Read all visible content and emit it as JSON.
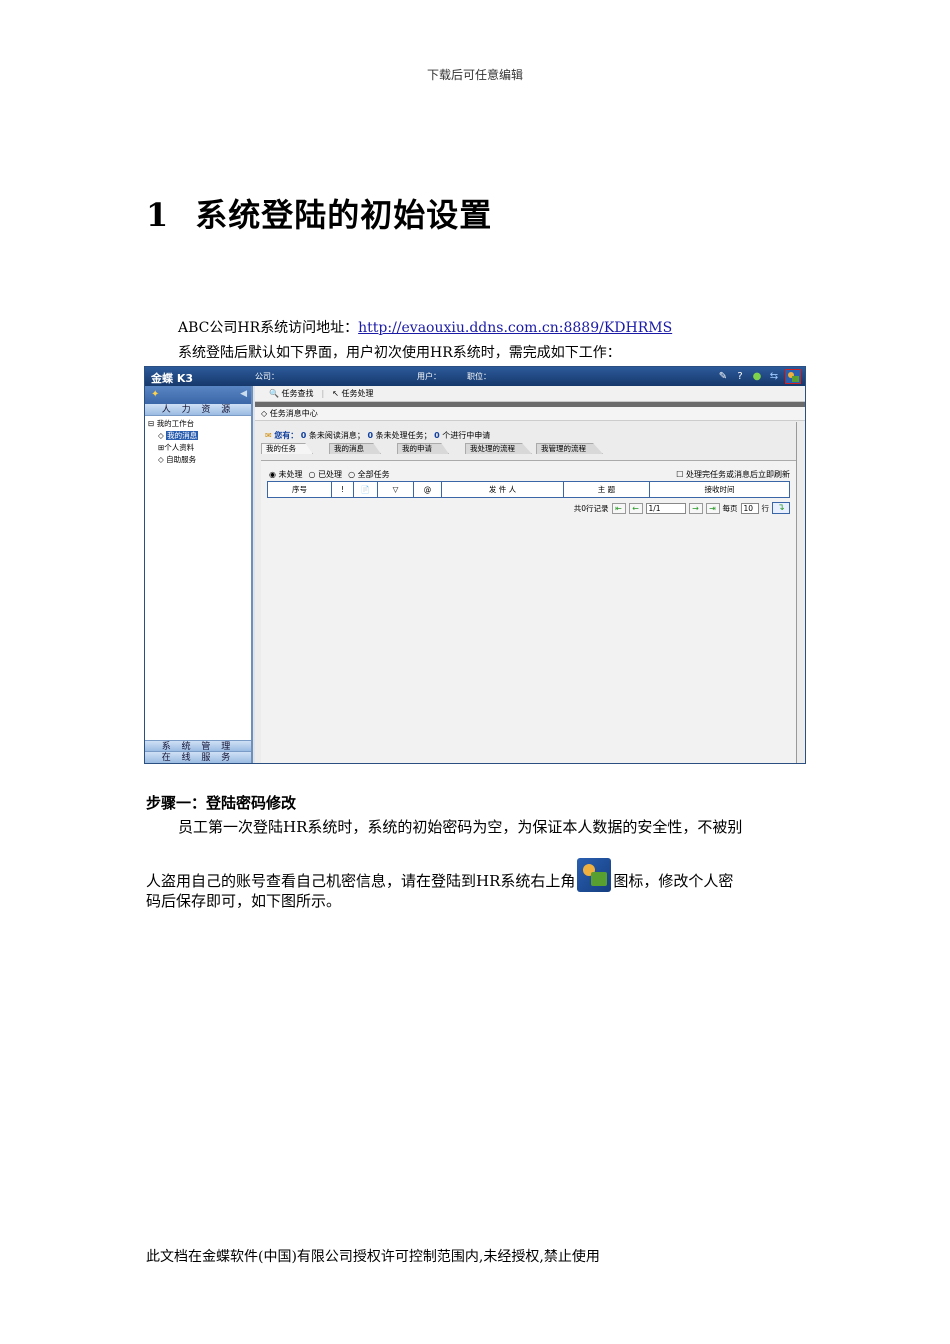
{
  "doc": {
    "header_note": "下载后可任意编辑",
    "heading_number": "1",
    "heading_text": "系统登陆的初始设置",
    "access_label": "ABC公司HR系统访问地址：",
    "access_url": "http://evaouxiu.ddns.com.cn:8889/KDHRMS",
    "intro_line": "系统登陆后默认如下界面，用户初次使用HR系统时，需完成如下工作：",
    "step1_title": "步骤一：登陆密码修改",
    "body_line1": "员工第一次登陆HR系统时，系统的初始密码为空，为保证本人数据的安全性，不被别",
    "body_line2_a": "人盗用自己的账号查看自己机密信息，请在登陆到HR系统右上角",
    "body_line2_b": "图标，修改个人密",
    "body_line3": "码后保存即可，如下图所示。",
    "footer_note": "此文档在金蝶软件(中国)有限公司授权许可控制范围内,未经授权,禁止使用"
  },
  "app": {
    "brand": "金蝶 K3",
    "company_label": "公司：",
    "user_label": "用户：",
    "position_label": "职位：",
    "top_icons": [
      "tool-icon",
      "help-icon",
      "status-dot-icon",
      "arrows-icon",
      "key-user-icon"
    ],
    "sidebar": {
      "category_top": "人 力 资 源",
      "tree": [
        {
          "label": "我的工作台",
          "prefix": "⊟"
        },
        {
          "label": "我的消息",
          "prefix": "◇",
          "selected": true
        },
        {
          "label": "个人资料",
          "prefix": "⊞"
        },
        {
          "label": "自助服务",
          "prefix": "◇"
        }
      ],
      "category_bottom1": "系 统 管 理",
      "category_bottom2": "在 线 服 务"
    },
    "toolbar": {
      "task_search": "任务查找",
      "task_process": "任务处理"
    },
    "message_center": "任务消息中心",
    "stats": {
      "prefix": "您有：",
      "unread_count": "0",
      "unread_label": "条未阅读消息；",
      "pending_count": "0",
      "pending_label": "条未处理任务；",
      "applying_count": "0",
      "applying_label": "个进行中申请"
    },
    "tabs": [
      "我的任务",
      "我的消息",
      "我的申请",
      "我处理的流程",
      "我管理的流程"
    ],
    "filters": {
      "unprocessed": "未处理",
      "processed": "已处理",
      "all": "全部任务",
      "refresh_option": "处理完任务或消息后立即刷新"
    },
    "columns": [
      "序号",
      "!",
      "📄",
      "▽",
      "@",
      "发 件 人",
      "主 题",
      "接收时间"
    ],
    "pager": {
      "records": "共0行记录",
      "page_value": "1/1",
      "per_page_label": "每页",
      "per_page_value": "10",
      "rows_label": "行"
    }
  }
}
